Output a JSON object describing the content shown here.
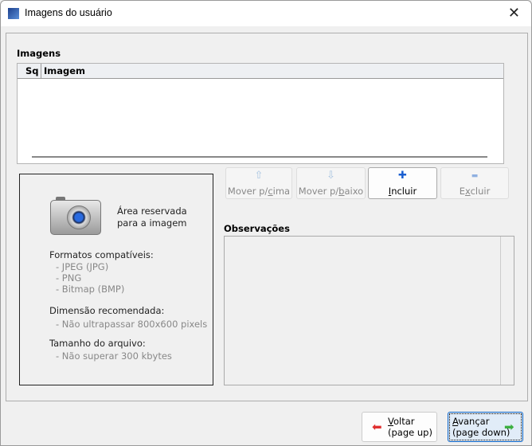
{
  "window": {
    "title": "Imagens do usuário",
    "close": "✕"
  },
  "images": {
    "label": "Imagens",
    "columns": [
      "Sq",
      "Imagem"
    ],
    "rows": []
  },
  "placeholder": {
    "caption_line1": "Área reservada",
    "caption_line2": "para a imagem",
    "formats_title": "Formatos compatíveis:",
    "formats": [
      "- JPEG (JPG)",
      "- PNG",
      "- Bitmap (BMP)"
    ],
    "dimension_title": "Dimensão recomendada:",
    "dimension": "- Não ultrapassar 800x600 pixels",
    "size_title": "Tamanho do arquivo:",
    "size": "- Não superar 300 kbytes"
  },
  "buttons": {
    "up": {
      "pre": "Mover p/",
      "acc": "c",
      "post": "ima",
      "icon": "⇧"
    },
    "down": {
      "pre": "Mover p/",
      "acc": "b",
      "post": "aixo",
      "icon": "⇩"
    },
    "add": {
      "pre": "",
      "acc": "I",
      "post": "ncluir",
      "icon": "✚"
    },
    "remove": {
      "pre": "E",
      "acc": "x",
      "post": "cluir",
      "icon": "▬"
    }
  },
  "observations": {
    "label": "Observações",
    "value": ""
  },
  "nav": {
    "back": {
      "acc": "V",
      "post": "oltar",
      "line2": "(page up)"
    },
    "next": {
      "acc": "A",
      "post": "vançar",
      "line2": "(page down)"
    }
  },
  "colors": {
    "back_arrow": "#e03030",
    "next_arrow": "#3cb040",
    "add_icon": "#1a5fd0"
  }
}
